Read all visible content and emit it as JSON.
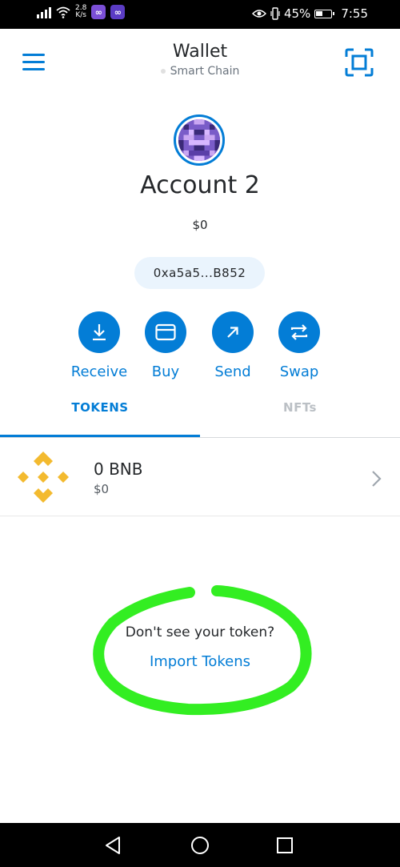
{
  "status_bar": {
    "speed_value": "2.8",
    "speed_unit": "K/s",
    "battery": "45%",
    "time": "7:55",
    "app_icon_1": "∞",
    "app_icon_2": "∞"
  },
  "header": {
    "title": "Wallet",
    "network": "Smart Chain",
    "menu_icon": "hamburger-menu-icon",
    "scan_icon": "qr-scan-icon"
  },
  "account": {
    "name": "Account 2",
    "balance": "$0",
    "address": "0xa5a5...B852"
  },
  "actions": [
    {
      "label": "Receive",
      "icon": "download-arrow-icon"
    },
    {
      "label": "Buy",
      "icon": "card-icon"
    },
    {
      "label": "Send",
      "icon": "arrow-up-right-icon"
    },
    {
      "label": "Swap",
      "icon": "swap-arrows-icon"
    }
  ],
  "tabs": [
    {
      "label": "TOKENS",
      "active": true
    },
    {
      "label": "NFTs",
      "active": false
    }
  ],
  "tokens": [
    {
      "amount": "0 BNB",
      "fiat": "$0",
      "icon": "bnb-logo-icon"
    }
  ],
  "import_prompt": {
    "text": "Don't see your token?",
    "link": "Import Tokens"
  },
  "colors": {
    "accent": "#037dd6",
    "address_pill_bg": "#eaf4fd",
    "bnb_yellow": "#f3ba2f",
    "scribble_green": "#33ee22"
  }
}
